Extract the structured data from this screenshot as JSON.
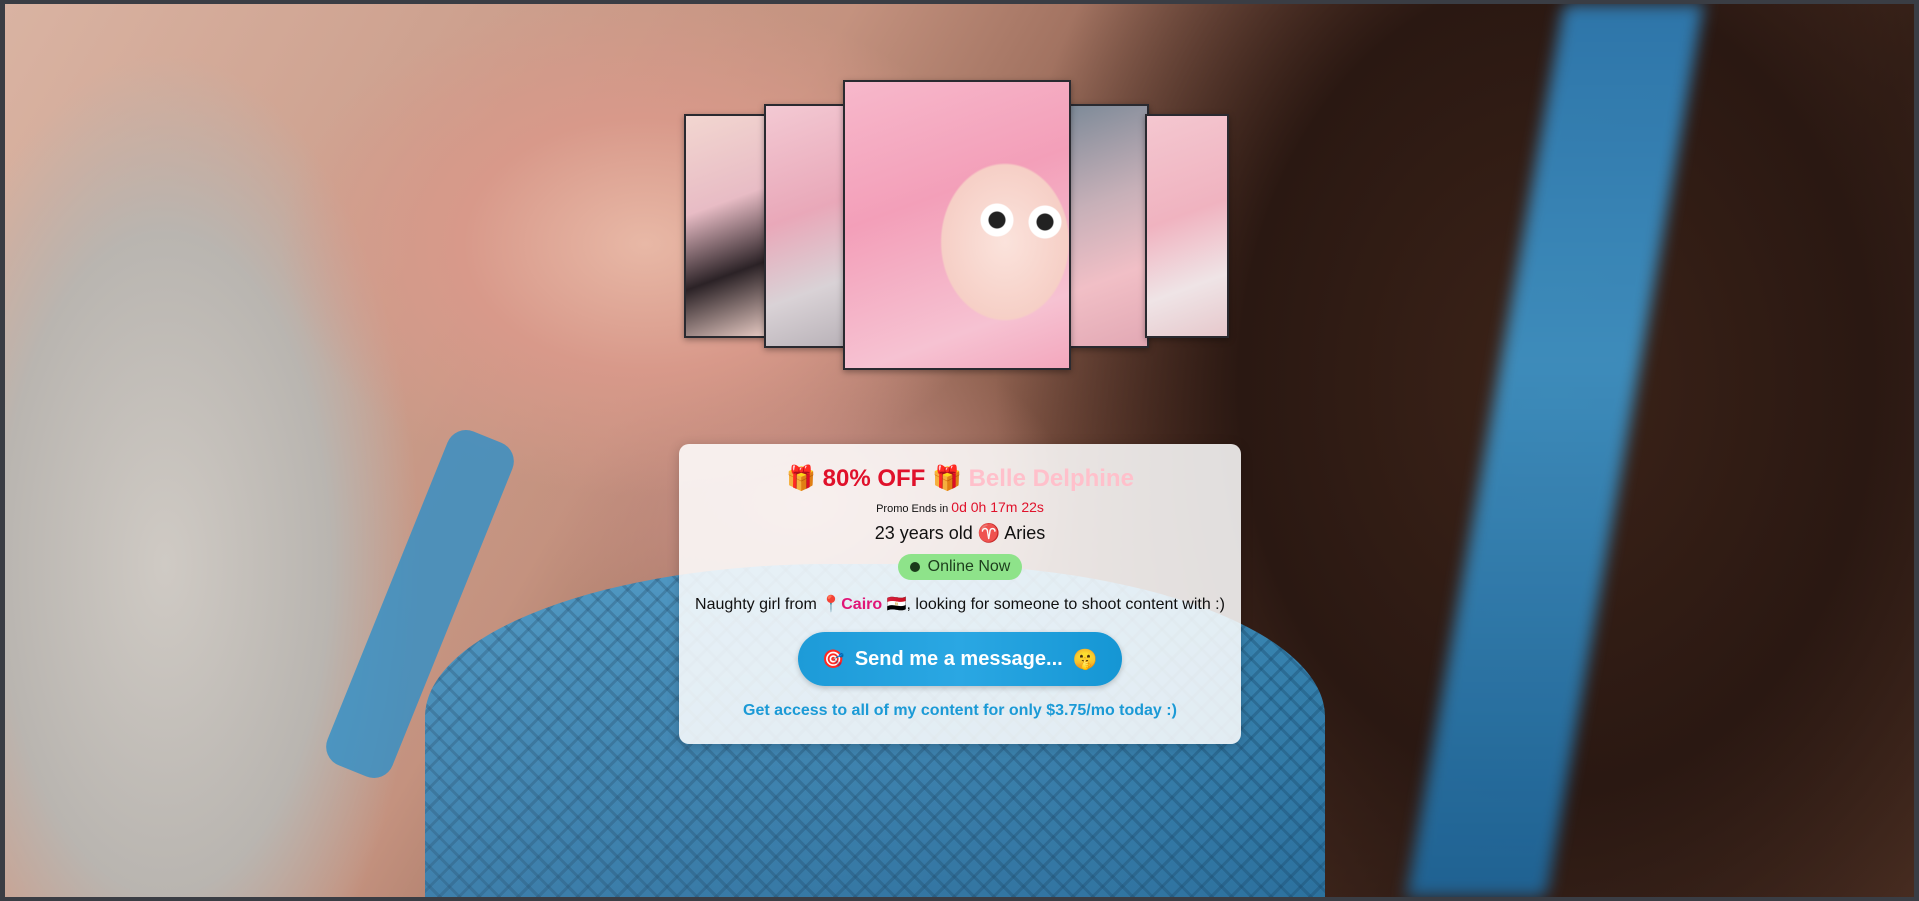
{
  "gallery": {
    "photos": [
      "photo-1",
      "photo-2",
      "photo-3",
      "photo-4",
      "photo-5"
    ]
  },
  "card": {
    "offer_prefix_icon": "🎁",
    "offer_text": "80% OFF",
    "offer_suffix_icon": "🎁",
    "model_name": "Belle Delphine",
    "promo_label": "Promo Ends in",
    "promo_timer": "0d 0h 17m 22s",
    "age_text": "23 years old",
    "zodiac_icon": "♈",
    "zodiac": "Aries",
    "status": "Online Now",
    "bio_prefix": "Naughty girl from",
    "location_pin": "📍",
    "city": "Cairo",
    "flag": "🇪🇬",
    "bio_suffix": ", looking for someone to shoot content with :)",
    "cta_icon": "🎯",
    "cta_label": "Send me a message...",
    "cta_emoji": "🤫",
    "access_text": "Get access to all of my content for only $3.75/mo today :)"
  },
  "colors": {
    "offer_red": "#e0112b",
    "name_pink": "#ffc0cb",
    "city_pink": "#e01677",
    "online_green": "#8ee38a",
    "cta_blue": "#1d9bd8",
    "access_blue": "#1b9ad6"
  }
}
